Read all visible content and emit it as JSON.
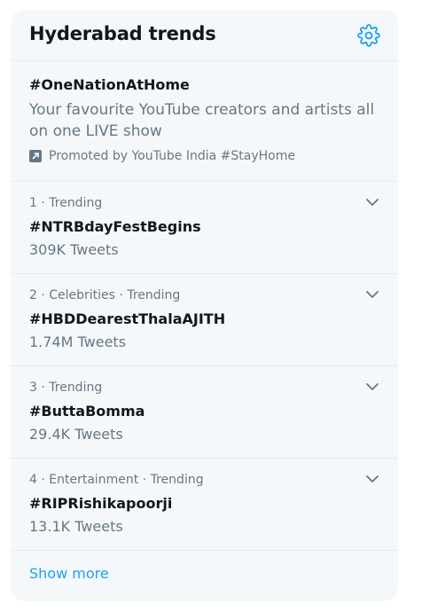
{
  "header": {
    "title": "Hyderabad trends",
    "settings_icon": "gear-icon"
  },
  "promoted": {
    "hashtag": "#OneNationAtHome",
    "description": "Your favourite YouTube creators and artists all on one LIVE show",
    "promoted_line": "Promoted by YouTube India #StayHome",
    "icon": "promoted-arrow-icon"
  },
  "trends": [
    {
      "meta": "1 · Trending",
      "name": "#NTRBdayFestBegins",
      "count": "309K Tweets"
    },
    {
      "meta": "2 · Celebrities · Trending",
      "name": "#HBDDearestThalaAJITH",
      "count": "1.74M Tweets"
    },
    {
      "meta": "3 · Trending",
      "name": "#ButtaBomma",
      "count": "29.4K Tweets"
    },
    {
      "meta": "4 · Entertainment · Trending",
      "name": "#RIPRishikapoorji",
      "count": "13.1K Tweets"
    }
  ],
  "footer": {
    "show_more": "Show more"
  },
  "colors": {
    "accent": "#1da1f2",
    "text": "#14171a",
    "muted": "#657786",
    "background": "#f5f8fa"
  }
}
